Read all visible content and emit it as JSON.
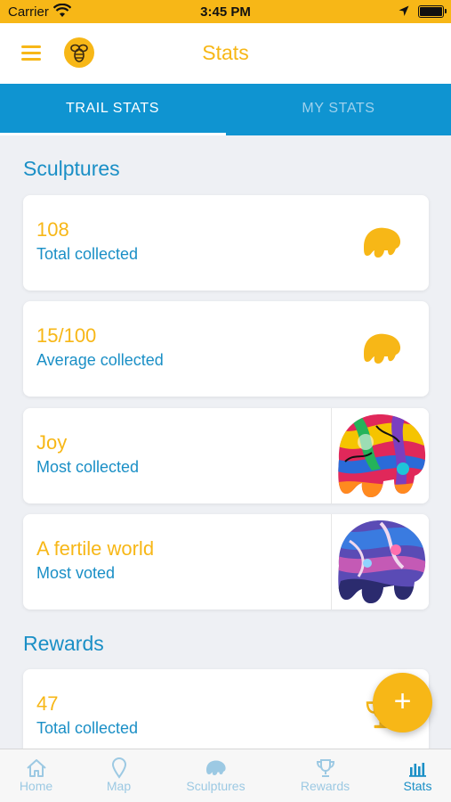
{
  "status": {
    "carrier": "Carrier",
    "time": "3:45 PM"
  },
  "header": {
    "title": "Stats",
    "menu_icon": "hamburger-menu-icon",
    "logo_icon": "bee-logo-icon"
  },
  "tabs": [
    {
      "label": "TRAIL STATS",
      "active": true
    },
    {
      "label": "MY STATS",
      "active": false
    }
  ],
  "sculptures": {
    "title": "Sculptures",
    "cards": [
      {
        "value": "108",
        "label": "Total collected",
        "icon": "bear-icon"
      },
      {
        "value": "15/100",
        "label": "Average collected",
        "icon": "bear-icon"
      },
      {
        "value": "Joy",
        "label": "Most collected",
        "image": "colorful-bear-sculpture"
      },
      {
        "value": "A fertile world",
        "label": "Most voted",
        "image": "purple-bear-sculpture"
      }
    ]
  },
  "rewards": {
    "title": "Rewards",
    "cards": [
      {
        "value": "47",
        "label": "Total collected",
        "icon": "trophy-icon"
      }
    ]
  },
  "fab": {
    "label": "+",
    "icon": "plus-icon"
  },
  "bottom_nav": [
    {
      "label": "Home",
      "icon": "home-icon",
      "active": false
    },
    {
      "label": "Map",
      "icon": "map-pin-icon",
      "active": false
    },
    {
      "label": "Sculptures",
      "icon": "bear-icon",
      "active": false
    },
    {
      "label": "Rewards",
      "icon": "trophy-icon",
      "active": false
    },
    {
      "label": "Stats",
      "icon": "bar-chart-icon",
      "active": true
    }
  ],
  "colors": {
    "accent": "#f7b717",
    "primary": "#0f94d1",
    "text_blue": "#1a8fc6",
    "background": "#eef0f4"
  }
}
